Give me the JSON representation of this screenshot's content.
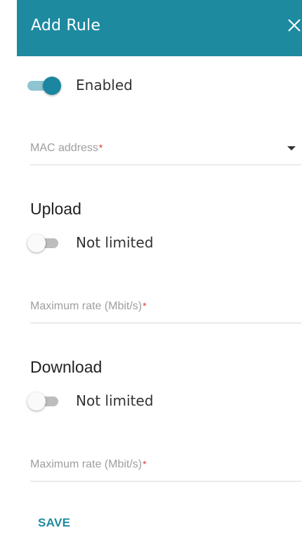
{
  "dialog": {
    "title": "Add Rule",
    "close_icon": "close-icon",
    "header_color": "#1d8aa0"
  },
  "enabled": {
    "label": "Enabled",
    "state": true
  },
  "mac_address": {
    "placeholder": "MAC address",
    "required_mark": "*"
  },
  "upload": {
    "title": "Upload",
    "toggle_label": "Not limited",
    "toggle_state": false,
    "rate_placeholder": "Maximum rate (Mbit/s)",
    "required_mark": "*"
  },
  "download": {
    "title": "Download",
    "toggle_label": "Not limited",
    "toggle_state": false,
    "rate_placeholder": "Maximum rate (Mbit/s)",
    "required_mark": "*"
  },
  "actions": {
    "save_label": "SAVE"
  },
  "colors": {
    "accent": "#1d8aa0",
    "required": "#e53935"
  }
}
